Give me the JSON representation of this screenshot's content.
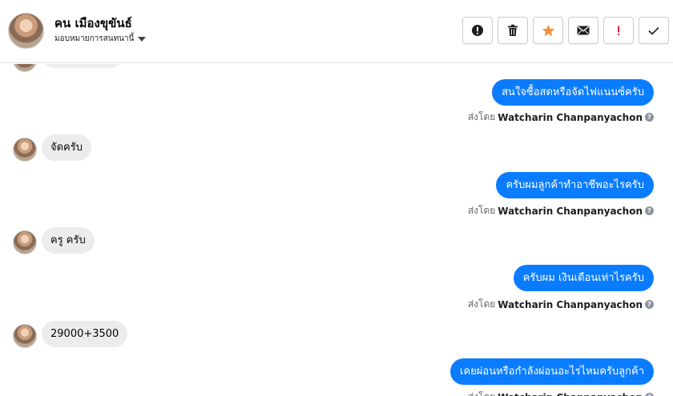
{
  "header": {
    "contact_name": "คน เมืองขุขันธ์",
    "assign_label": "มอบหมายการสนทนานี้",
    "actions": [
      {
        "name": "spam-button",
        "icon": "exclamation-circle-icon"
      },
      {
        "name": "delete-button",
        "icon": "trash-icon"
      },
      {
        "name": "star-button",
        "icon": "star-icon",
        "color": "#f5923e"
      },
      {
        "name": "mark-unread-button",
        "icon": "envelope-icon"
      },
      {
        "name": "follow-up-button",
        "icon": "exclamation-icon",
        "color": "#e41e3f"
      },
      {
        "name": "mark-done-button",
        "icon": "checkmark-icon"
      }
    ]
  },
  "thread": {
    "messages": [
      {
        "direction": "incoming",
        "text": ""
      },
      {
        "direction": "outgoing",
        "text": "สนใจซื้อสดหรือจัดไฟแนนซ์ครับ"
      },
      {
        "direction": "incoming",
        "text": "จัดครับ"
      },
      {
        "direction": "outgoing",
        "text": "ครับผมลูกค้าทำอาชีพอะไรครับ"
      },
      {
        "direction": "incoming",
        "text": "ครู ครับ"
      },
      {
        "direction": "outgoing",
        "text": "ครับผม เงินเดือนเท่าไรครับ"
      },
      {
        "direction": "incoming",
        "text": "29000+3500"
      },
      {
        "direction": "outgoing",
        "text": "เคยผ่อนหรือกำลังผ่อนอะไรไหมครับลูกค้า"
      }
    ],
    "sent_by_prefix": "ส่งโดย",
    "sent_by_name": "Watcharin Chanpanyachon",
    "help_glyph": "?"
  },
  "colors": {
    "outgoing_bubble": "#0a7cff",
    "incoming_bubble": "#ececec"
  }
}
